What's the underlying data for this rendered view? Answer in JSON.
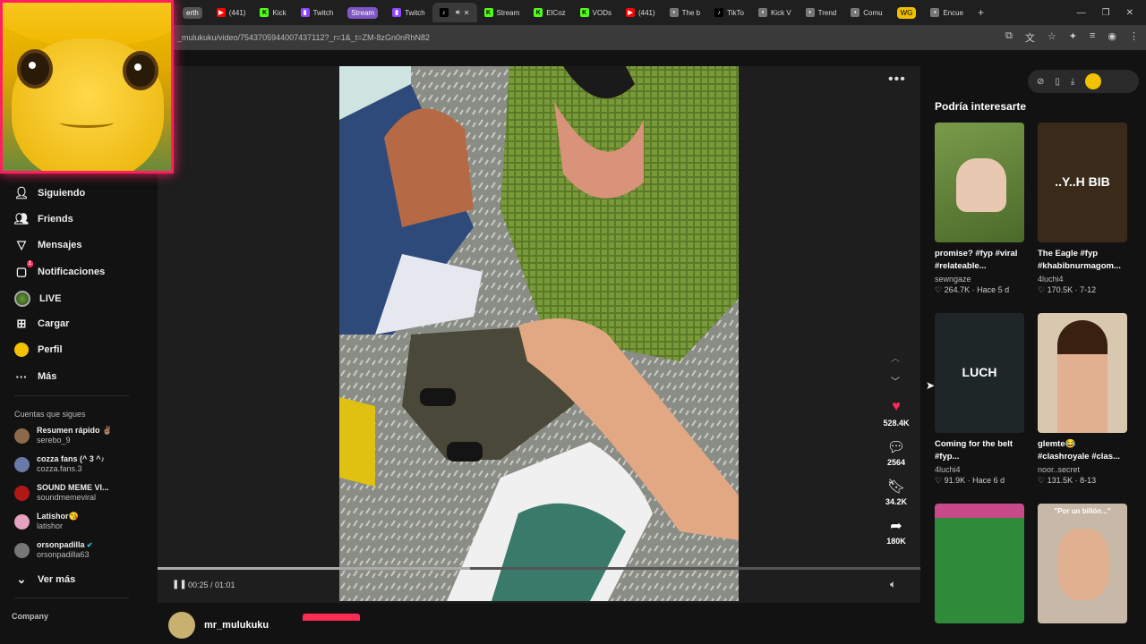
{
  "browser": {
    "tabs": [
      {
        "label": "erth",
        "style": "grey"
      },
      {
        "label": "(441)",
        "icon": "youtube"
      },
      {
        "label": "Kick",
        "icon": "kick"
      },
      {
        "label": "Twitch",
        "icon": "twitch"
      },
      {
        "label": "Stream",
        "style": "purple"
      },
      {
        "label": "Twitch",
        "icon": "twitch"
      },
      {
        "label": "",
        "icon": "tiktok",
        "active": true
      },
      {
        "label": "Stream",
        "icon": "kick"
      },
      {
        "label": "ElCoz",
        "icon": "kick"
      },
      {
        "label": "VODs",
        "icon": "kick"
      },
      {
        "label": "(441)",
        "icon": "youtube"
      },
      {
        "label": "The b",
        "icon": "generic"
      },
      {
        "label": "TikTo",
        "icon": "tiktok"
      },
      {
        "label": "Kick V",
        "icon": "generic"
      },
      {
        "label": "Trend",
        "icon": "generic"
      },
      {
        "label": "Comu",
        "icon": "generic"
      },
      {
        "label": "WG",
        "style": "wg"
      },
      {
        "label": "Encue",
        "icon": "generic"
      }
    ],
    "url": "_mulukuku/video/7543705944007437112?_r=1&_t=ZM-8zGn0nRhN82"
  },
  "sidebar": {
    "nav": [
      {
        "label": "Siguiendo",
        "icon": "user-follow-icon"
      },
      {
        "label": "Friends",
        "icon": "friends-icon"
      },
      {
        "label": "Mensajes",
        "icon": "messages-icon"
      },
      {
        "label": "Notificaciones",
        "icon": "notifications-icon",
        "badge": "1"
      },
      {
        "label": "LIVE",
        "icon": "live-avatar"
      },
      {
        "label": "Cargar",
        "icon": "upload-icon"
      },
      {
        "label": "Perfil",
        "icon": "profile-avatar"
      },
      {
        "label": "Más",
        "icon": "more-icon"
      }
    ],
    "following_title": "Cuentas que sigues",
    "accounts": [
      {
        "name": "Resumen rápido ✌🏽",
        "handle": "serebo_9",
        "color": "#8a6a4a"
      },
      {
        "name": "cozza fans (^ 3 ^♪",
        "handle": "cozza.fans.3",
        "color": "#6a7aa8"
      },
      {
        "name": "SOUND MEME VI...",
        "handle": "soundmemeviral",
        "color": "#b01818"
      },
      {
        "name": "Latishor😘",
        "handle": "latishor",
        "color": "#e6a0c0"
      },
      {
        "name": "orsonpadilla",
        "handle": "orsonpadilla63",
        "color": "#777777"
      }
    ],
    "see_more": "Ver más",
    "company": "Company"
  },
  "player": {
    "time": "00:25 / 01:01",
    "progress": 0.41,
    "actions": [
      {
        "name": "like",
        "count": "528.4K"
      },
      {
        "name": "comment",
        "count": "2564"
      },
      {
        "name": "save",
        "count": "34.2K"
      },
      {
        "name": "share",
        "count": "180K"
      }
    ],
    "author": "mr_mulukuku"
  },
  "recommended": {
    "title": "Podría interesarte",
    "cards": [
      {
        "title": "promise? #fyp #viral #relateable...",
        "user": "sewngaze",
        "stats": "♡ 264.7K · Hace 5 d",
        "bg": "#5f7a3e"
      },
      {
        "title": "The Eagle #fyp #khabibnurmagom...",
        "user": "4luchi4",
        "stats": "♡ 170.5K · 7-12",
        "bg": "#3a2a1a",
        "overlay": "..Y..H BIB"
      },
      {
        "title": "Coming for the belt #fyp...",
        "user": "4luchi4",
        "stats": "♡ 91.9K · Hace 6 d",
        "bg": "#1e2628",
        "overlay": "LUCH"
      },
      {
        "title": "glemte😂 #clashroyale #clas...",
        "user": "noor..secret",
        "stats": "♡ 131.5K · 8-13",
        "bg": "#d8c8b0"
      },
      {
        "title": "",
        "user": "",
        "stats": "",
        "bg": "#2f7a3a"
      },
      {
        "title": "",
        "user": "",
        "stats": "",
        "bg": "#c8b8a8",
        "overlay": "\"Por un billón...\""
      }
    ]
  }
}
